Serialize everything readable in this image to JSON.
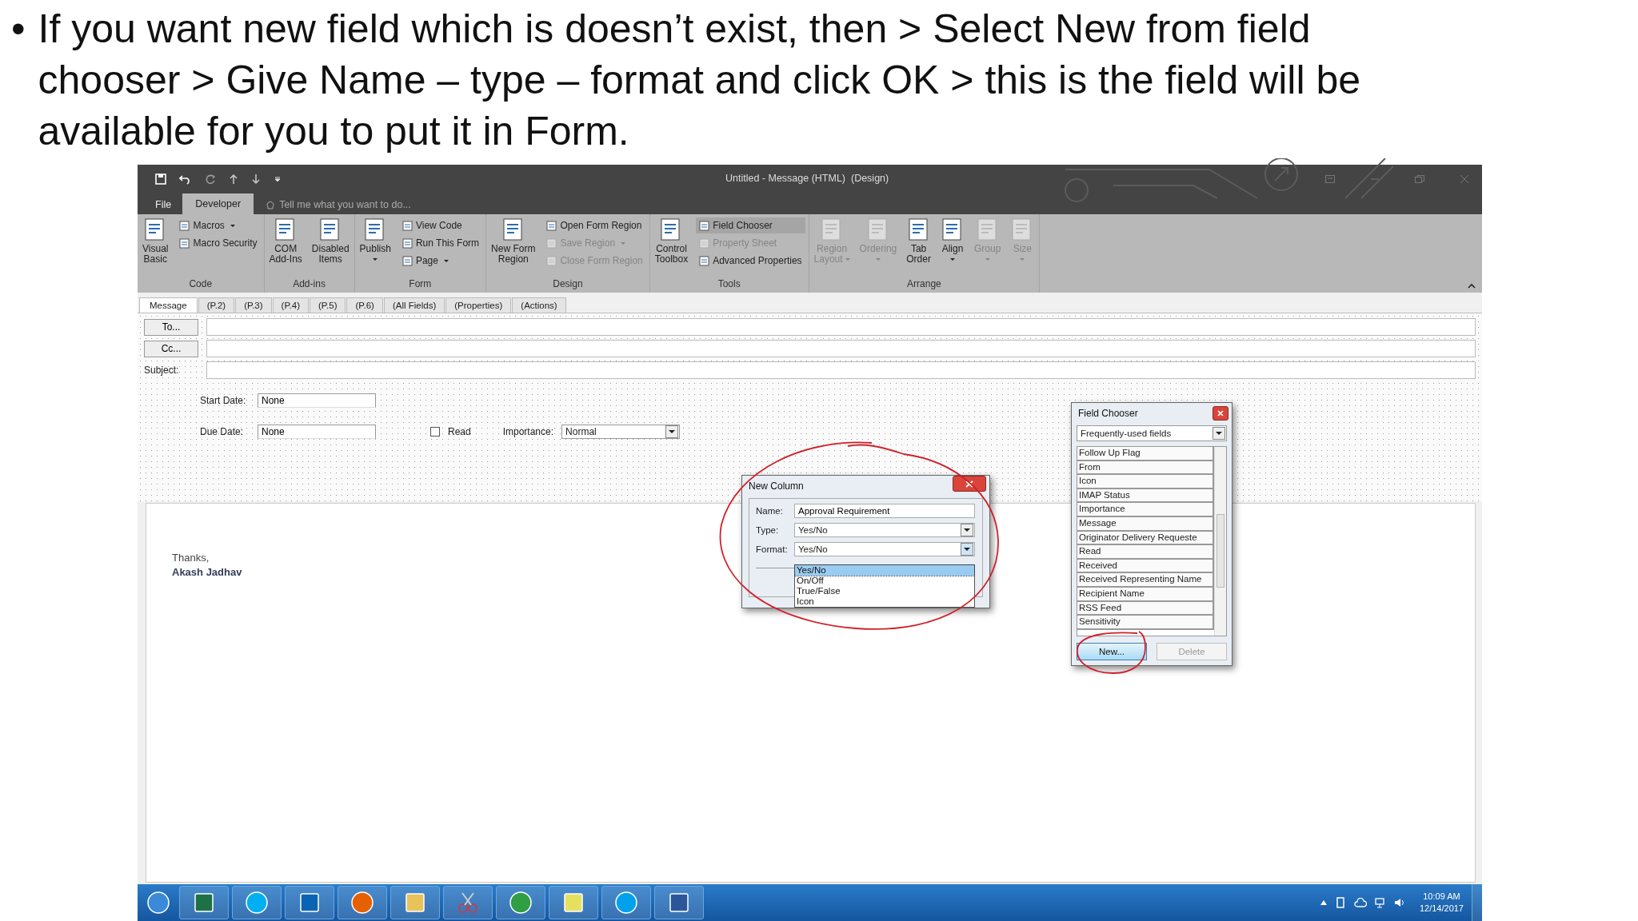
{
  "slide": {
    "bullet": "•",
    "text": "If you want new field which is doesn’t exist, then > Select New from field chooser > Give Name – type – format and click OK > this is the field will be available for you to put it in Form."
  },
  "window": {
    "title": "Untitled - Message (HTML)  (Design)"
  },
  "menu_tabs": [
    {
      "label": "File",
      "selected": false
    },
    {
      "label": "Developer",
      "selected": true
    }
  ],
  "tell_me": {
    "placeholder": "Tell me what you want to do..."
  },
  "ribbon_groups": [
    {
      "label": "Code",
      "columns": [
        {
          "items": [
            {
              "kind": "large",
              "lines": [
                "Visual",
                "Basic"
              ],
              "dropdown": false,
              "disabled": false
            }
          ]
        },
        {
          "items": [
            {
              "kind": "small",
              "lines": [
                "Macros"
              ],
              "dropdown": true,
              "disabled": false,
              "on": false
            },
            {
              "kind": "small",
              "lines": [
                "Macro Security"
              ],
              "dropdown": false,
              "disabled": false,
              "on": false
            }
          ]
        }
      ]
    },
    {
      "label": "Add-ins",
      "columns": [
        {
          "items": [
            {
              "kind": "large",
              "lines": [
                "COM",
                "Add-Ins"
              ],
              "dropdown": false,
              "disabled": false
            }
          ]
        },
        {
          "items": [
            {
              "kind": "large",
              "lines": [
                "Disabled",
                "Items"
              ],
              "dropdown": false,
              "disabled": false
            }
          ]
        }
      ]
    },
    {
      "label": "Form",
      "columns": [
        {
          "items": [
            {
              "kind": "large",
              "lines": [
                "Publish"
              ],
              "dropdown": true,
              "disabled": false
            }
          ]
        },
        {
          "items": [
            {
              "kind": "small",
              "lines": [
                "View Code"
              ],
              "dropdown": false,
              "disabled": false,
              "on": false
            },
            {
              "kind": "small",
              "lines": [
                "Run This Form"
              ],
              "dropdown": false,
              "disabled": false,
              "on": false
            },
            {
              "kind": "small",
              "lines": [
                "Page"
              ],
              "dropdown": true,
              "disabled": false,
              "on": false
            }
          ]
        }
      ]
    },
    {
      "label": "Design",
      "columns": [
        {
          "items": [
            {
              "kind": "large",
              "lines": [
                "New Form",
                "Region"
              ],
              "dropdown": false,
              "disabled": false
            }
          ]
        },
        {
          "items": [
            {
              "kind": "small",
              "lines": [
                "Open Form Region"
              ],
              "dropdown": false,
              "disabled": false,
              "on": false
            },
            {
              "kind": "small",
              "lines": [
                "Save Region"
              ],
              "dropdown": true,
              "disabled": true,
              "on": false
            },
            {
              "kind": "small",
              "lines": [
                "Close Form Region"
              ],
              "dropdown": false,
              "disabled": true,
              "on": false
            }
          ]
        }
      ]
    },
    {
      "label": "Tools",
      "columns": [
        {
          "items": [
            {
              "kind": "large",
              "lines": [
                "Control",
                "Toolbox"
              ],
              "dropdown": false,
              "disabled": false
            }
          ]
        },
        {
          "items": [
            {
              "kind": "small",
              "lines": [
                "Field Chooser"
              ],
              "dropdown": false,
              "disabled": false,
              "on": true
            },
            {
              "kind": "small",
              "lines": [
                "Property Sheet"
              ],
              "dropdown": false,
              "disabled": true,
              "on": false
            },
            {
              "kind": "small",
              "lines": [
                "Advanced Properties"
              ],
              "dropdown": false,
              "disabled": false,
              "on": false
            }
          ]
        }
      ]
    },
    {
      "label": "Arrange",
      "columns": [
        {
          "items": [
            {
              "kind": "large",
              "lines": [
                "Region",
                "Layout"
              ],
              "dropdown": true,
              "disabled": true
            }
          ]
        },
        {
          "items": [
            {
              "kind": "large",
              "lines": [
                "Ordering"
              ],
              "dropdown": true,
              "disabled": true
            }
          ]
        },
        {
          "items": [
            {
              "kind": "large",
              "lines": [
                "Tab",
                "Order"
              ],
              "dropdown": false,
              "disabled": false
            }
          ]
        },
        {
          "items": [
            {
              "kind": "large",
              "lines": [
                "Align"
              ],
              "dropdown": true,
              "disabled": false
            }
          ]
        },
        {
          "items": [
            {
              "kind": "large",
              "lines": [
                "Group"
              ],
              "dropdown": true,
              "disabled": true
            }
          ]
        },
        {
          "items": [
            {
              "kind": "large",
              "lines": [
                "Size"
              ],
              "dropdown": true,
              "disabled": true
            }
          ]
        }
      ]
    }
  ],
  "page_tabs": [
    {
      "label": "Message",
      "selected": true
    },
    {
      "label": "(P.2)",
      "selected": false
    },
    {
      "label": "(P.3)",
      "selected": false
    },
    {
      "label": "(P.4)",
      "selected": false
    },
    {
      "label": "(P.5)",
      "selected": false
    },
    {
      "label": "(P.6)",
      "selected": false
    },
    {
      "label": "(All Fields)",
      "selected": false
    },
    {
      "label": "(Properties)",
      "selected": false
    },
    {
      "label": "(Actions)",
      "selected": false
    }
  ],
  "address_rows": [
    {
      "kind": "button",
      "label": "To..."
    },
    {
      "kind": "button",
      "label": "Cc..."
    },
    {
      "kind": "label",
      "label": "Subject:"
    }
  ],
  "start_date": {
    "label": "Start Date:",
    "value": "None"
  },
  "due_date": {
    "label": "Due Date:",
    "value": "None"
  },
  "read": {
    "label": "Read",
    "checked": false
  },
  "importance": {
    "label": "Importance:",
    "value": "Normal"
  },
  "body": [
    {
      "text": "Thanks,",
      "bold": false
    },
    {
      "text": "Akash Jadhav",
      "bold": true
    }
  ],
  "new_column": {
    "title": "New Column",
    "name": {
      "label": "Name:",
      "value": "Approval Requirement"
    },
    "type": {
      "label": "Type:",
      "value": "Yes/No"
    },
    "format": {
      "label": "Format:",
      "value": "Yes/No"
    },
    "options": [
      {
        "label": "Yes/No",
        "selected": true
      },
      {
        "label": "On/Off",
        "selected": false
      },
      {
        "label": "True/False",
        "selected": false
      },
      {
        "label": "Icon",
        "selected": false
      }
    ]
  },
  "field_chooser": {
    "title": "Field Chooser",
    "category": "Frequently-used fields",
    "items": [
      "Follow Up Flag",
      "From",
      "Icon",
      "IMAP Status",
      "Importance",
      "Message",
      "Originator Delivery Requeste",
      "Read",
      "Received",
      "Received Representing Name",
      "Recipient Name",
      "RSS Feed",
      "Sensitivity"
    ],
    "buttons": [
      {
        "label": "New...",
        "disabled": false
      },
      {
        "label": "Delete",
        "disabled": true
      }
    ]
  },
  "clock": {
    "time": "10:09 AM",
    "date": "12/14/2017"
  }
}
